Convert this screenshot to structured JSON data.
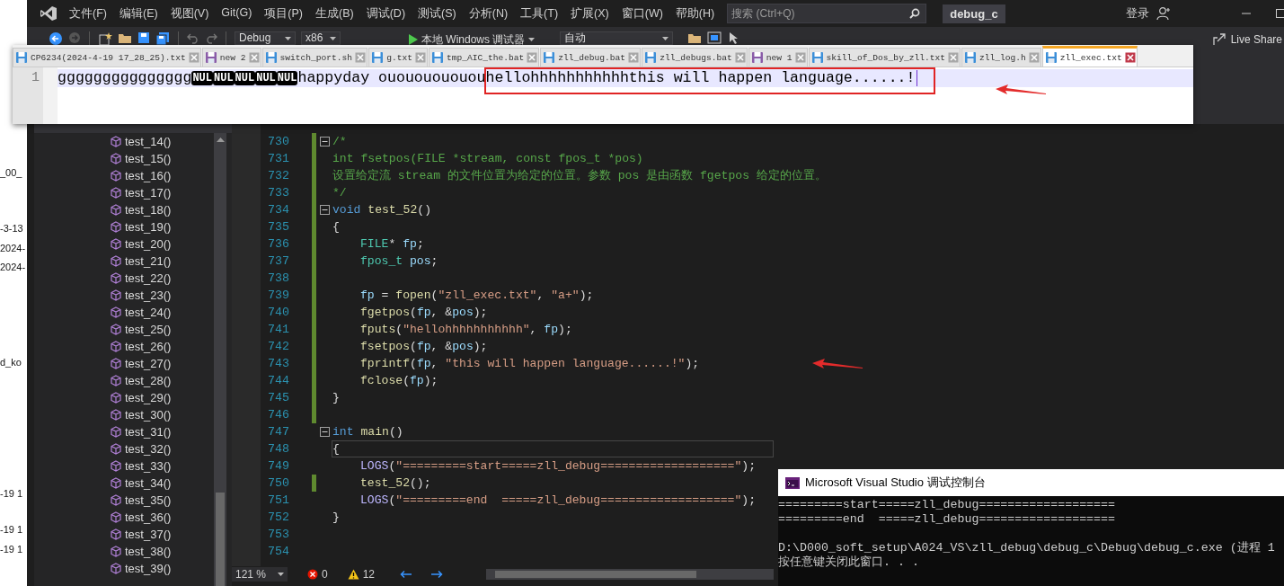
{
  "background_window": {
    "fragments": [
      "_00_",
      "-3-13",
      "2024-",
      "2024-",
      "d_ko",
      "-19 1",
      "-19 1",
      "-19 1"
    ]
  },
  "vs": {
    "menu": [
      "文件(F)",
      "编辑(E)",
      "视图(V)",
      "Git(G)",
      "项目(P)",
      "生成(B)",
      "调试(D)",
      "测试(S)",
      "分析(N)",
      "工具(T)",
      "扩展(X)",
      "窗口(W)",
      "帮助(H)"
    ],
    "search": {
      "placeholder": "搜索 (Ctrl+Q)"
    },
    "solution": "debug_c",
    "sign_in": "登录",
    "toolbar": {
      "configuration": "Debug",
      "platform": "x86",
      "run": "本地 Windows 调试器",
      "target": "自动",
      "live_share": "Live Share"
    },
    "class_view": {
      "items": [
        "test_14()",
        "test_15()",
        "test_16()",
        "test_17()",
        "test_18()",
        "test_19()",
        "test_20()",
        "test_21()",
        "test_22()",
        "test_23()",
        "test_24()",
        "test_25()",
        "test_26()",
        "test_27()",
        "test_28()",
        "test_29()",
        "test_30()",
        "test_31()",
        "test_32()",
        "test_33()",
        "test_34()",
        "test_35()",
        "test_36()",
        "test_37()",
        "test_38()",
        "test_39()"
      ]
    },
    "editor": {
      "lines": [
        {
          "number": "730",
          "changed": true,
          "fold": true,
          "indented": false,
          "current": false,
          "tokens": [
            {
              "kind": "comment",
              "text": "/*"
            }
          ]
        },
        {
          "number": "731",
          "changed": true,
          "fold": false,
          "indented": false,
          "current": false,
          "tokens": [
            {
              "kind": "comment",
              "text": "int fsetpos(FILE *stream, const fpos_t *pos)"
            }
          ]
        },
        {
          "number": "732",
          "changed": true,
          "fold": false,
          "indented": false,
          "current": false,
          "tokens": [
            {
              "kind": "comment",
              "text": "设置给定流 stream 的文件位置为给定的位置。参数 pos 是由函数 fgetpos 给定的位置。"
            }
          ]
        },
        {
          "number": "733",
          "changed": true,
          "fold": false,
          "indented": false,
          "current": false,
          "tokens": [
            {
              "kind": "comment",
              "text": "*/"
            }
          ]
        },
        {
          "number": "734",
          "changed": true,
          "fold": true,
          "indented": false,
          "current": false,
          "tokens": [
            {
              "kind": "keyword",
              "text": "void "
            },
            {
              "kind": "func",
              "text": "test_52"
            },
            {
              "kind": "plain",
              "text": "()"
            }
          ]
        },
        {
          "number": "735",
          "changed": true,
          "fold": false,
          "indented": false,
          "current": false,
          "tokens": [
            {
              "kind": "plain",
              "text": "{"
            }
          ]
        },
        {
          "number": "736",
          "changed": true,
          "fold": false,
          "indented": true,
          "current": false,
          "tokens": [
            {
              "kind": "type",
              "text": "FILE"
            },
            {
              "kind": "plain",
              "text": "* "
            },
            {
              "kind": "var",
              "text": "fp"
            },
            {
              "kind": "plain",
              "text": ";"
            }
          ]
        },
        {
          "number": "737",
          "changed": true,
          "fold": false,
          "indented": true,
          "current": false,
          "tokens": [
            {
              "kind": "type",
              "text": "fpos_t "
            },
            {
              "kind": "var",
              "text": "pos"
            },
            {
              "kind": "plain",
              "text": ";"
            }
          ]
        },
        {
          "number": "738",
          "changed": true,
          "fold": false
        },
        {
          "number": "739",
          "changed": true,
          "fold": false,
          "indented": true,
          "current": false,
          "tokens": [
            {
              "kind": "var",
              "text": "fp"
            },
            {
              "kind": "plain",
              "text": " = "
            },
            {
              "kind": "func",
              "text": "fopen"
            },
            {
              "kind": "plain",
              "text": "("
            },
            {
              "kind": "string",
              "text": "\"zll_exec.txt\""
            },
            {
              "kind": "plain",
              "text": ", "
            },
            {
              "kind": "string",
              "text": "\"a+\""
            },
            {
              "kind": "plain",
              "text": ");"
            }
          ]
        },
        {
          "number": "740",
          "changed": true,
          "fold": false,
          "indented": true,
          "current": false,
          "tokens": [
            {
              "kind": "func",
              "text": "fgetpos"
            },
            {
              "kind": "plain",
              "text": "("
            },
            {
              "kind": "var",
              "text": "fp"
            },
            {
              "kind": "plain",
              "text": ", &"
            },
            {
              "kind": "var",
              "text": "pos"
            },
            {
              "kind": "plain",
              "text": ");"
            }
          ]
        },
        {
          "number": "741",
          "changed": true,
          "fold": false,
          "indented": true,
          "current": false,
          "tokens": [
            {
              "kind": "func",
              "text": "fputs"
            },
            {
              "kind": "plain",
              "text": "("
            },
            {
              "kind": "string",
              "text": "\"hellohhhhhhhhhhh\""
            },
            {
              "kind": "plain",
              "text": ", "
            },
            {
              "kind": "var",
              "text": "fp"
            },
            {
              "kind": "plain",
              "text": ");"
            }
          ]
        },
        {
          "number": "742",
          "changed": true,
          "fold": false,
          "indented": true,
          "current": false,
          "tokens": [
            {
              "kind": "func",
              "text": "fsetpos"
            },
            {
              "kind": "plain",
              "text": "("
            },
            {
              "kind": "var",
              "text": "fp"
            },
            {
              "kind": "plain",
              "text": ", &"
            },
            {
              "kind": "var",
              "text": "pos"
            },
            {
              "kind": "plain",
              "text": ");"
            }
          ]
        },
        {
          "number": "743",
          "changed": true,
          "fold": false,
          "indented": true,
          "current": false,
          "tokens": [
            {
              "kind": "func",
              "text": "fprintf"
            },
            {
              "kind": "plain",
              "text": "("
            },
            {
              "kind": "var",
              "text": "fp"
            },
            {
              "kind": "plain",
              "text": ", "
            },
            {
              "kind": "string",
              "text": "\"this will happen language......!\""
            },
            {
              "kind": "plain",
              "text": ");"
            }
          ]
        },
        {
          "number": "744",
          "changed": true,
          "fold": false,
          "indented": true,
          "current": false,
          "tokens": [
            {
              "kind": "func",
              "text": "fclose"
            },
            {
              "kind": "plain",
              "text": "("
            },
            {
              "kind": "var",
              "text": "fp"
            },
            {
              "kind": "plain",
              "text": ");"
            }
          ]
        },
        {
          "number": "745",
          "changed": true,
          "fold": false,
          "indented": false,
          "current": false,
          "tokens": [
            {
              "kind": "plain",
              "text": "}"
            }
          ]
        },
        {
          "number": "746",
          "changed": true,
          "fold": false
        },
        {
          "number": "747",
          "changed": false,
          "fold": true,
          "indented": false,
          "current": false,
          "tokens": [
            {
              "kind": "keyword",
              "text": "int "
            },
            {
              "kind": "func",
              "text": "main"
            },
            {
              "kind": "plain",
              "text": "()"
            }
          ]
        },
        {
          "number": "748",
          "changed": false,
          "fold": false,
          "indented": false,
          "current": true,
          "tokens": [
            {
              "kind": "plain",
              "text": "{"
            }
          ]
        },
        {
          "number": "749",
          "changed": false,
          "fold": false,
          "indented": true,
          "current": false,
          "tokens": [
            {
              "kind": "macro",
              "text": "LOGS"
            },
            {
              "kind": "plain",
              "text": "("
            },
            {
              "kind": "string",
              "text": "\"=========start=====zll_debug===================\""
            },
            {
              "kind": "plain",
              "text": ");"
            }
          ]
        },
        {
          "number": "750",
          "changed": true,
          "fold": false,
          "indented": true,
          "current": false,
          "tokens": [
            {
              "kind": "func",
              "text": "test_52"
            },
            {
              "kind": "plain",
              "text": "();"
            }
          ]
        },
        {
          "number": "751",
          "changed": false,
          "fold": false,
          "indented": true,
          "current": false,
          "tokens": [
            {
              "kind": "macro",
              "text": "LOGS"
            },
            {
              "kind": "plain",
              "text": "("
            },
            {
              "kind": "string",
              "text": "\"=========end  =====zll_debug===================\""
            },
            {
              "kind": "plain",
              "text": ");"
            }
          ]
        },
        {
          "number": "752",
          "changed": false,
          "fold": false,
          "indented": false,
          "current": false,
          "tokens": [
            {
              "kind": "plain",
              "text": "}"
            }
          ]
        },
        {
          "number": "753",
          "changed": false,
          "fold": false
        },
        {
          "number": "754",
          "changed": false,
          "fold": false
        }
      ],
      "zoom": "121 %",
      "errors": "0",
      "warnings": "12"
    }
  },
  "notepad": {
    "tabs": [
      {
        "label": "CP6234(2024-4-19 17_28_25).txt",
        "kind": "saved",
        "selected": false
      },
      {
        "label": "new 2",
        "kind": "new",
        "selected": false
      },
      {
        "label": "switch_port.sh",
        "kind": "saved",
        "selected": false
      },
      {
        "label": "g.txt",
        "kind": "saved",
        "selected": false
      },
      {
        "label": "tmp_AIC_the.bat",
        "kind": "saved",
        "selected": false
      },
      {
        "label": "zll_debug.bat",
        "kind": "saved",
        "selected": false
      },
      {
        "label": "zll_debugs.bat",
        "kind": "saved",
        "selected": false
      },
      {
        "label": "new 1",
        "kind": "new",
        "selected": false
      },
      {
        "label": "skill_of_Dos_by_zll.txt",
        "kind": "saved",
        "selected": false
      },
      {
        "label": "zll_log.h",
        "kind": "saved",
        "selected": false
      },
      {
        "label": "zll_exec.txt",
        "kind": "saved",
        "selected": true
      }
    ],
    "line_number": "1",
    "segments": [
      {
        "kind": "text",
        "text": "ggggggggggggggg"
      },
      {
        "kind": "control",
        "text": "NUL"
      },
      {
        "kind": "control",
        "text": "NUL"
      },
      {
        "kind": "control",
        "text": "NUL"
      },
      {
        "kind": "control",
        "text": "NUL"
      },
      {
        "kind": "control",
        "text": "NUL"
      },
      {
        "kind": "text",
        "text": "happyday ouououououou"
      },
      {
        "kind": "highlighted",
        "text": "hellohhhhhhhhhhhthis will happen language......!"
      }
    ]
  },
  "console": {
    "title": "Microsoft Visual Studio 调试控制台",
    "blocks": [
      [
        "=========start=====zll_debug===================",
        "=========end  =====zll_debug==================="
      ],
      [
        "D:\\D000_soft_setup\\A024_VS\\zll_debug\\debug_c\\Debug\\debug_c.exe (进程 1",
        "按任意键关闭此窗口. . ."
      ]
    ]
  }
}
